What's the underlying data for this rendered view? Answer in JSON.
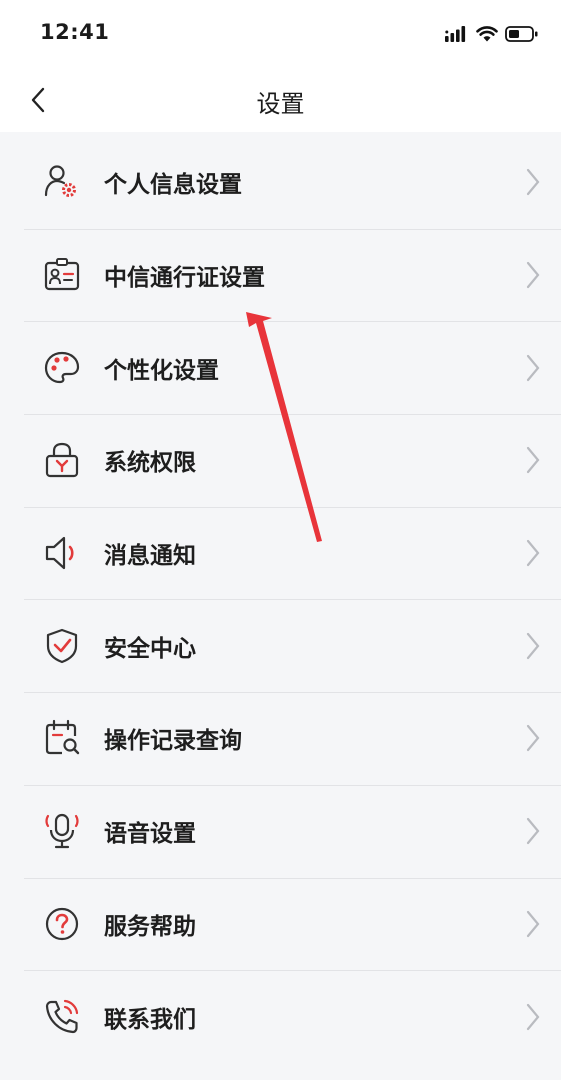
{
  "status_bar": {
    "time": "12:41"
  },
  "header": {
    "title": "设置"
  },
  "menu": {
    "items": [
      {
        "label": "个人信息设置",
        "icon": "user-gear-icon"
      },
      {
        "label": "中信通行证设置",
        "icon": "id-card-icon"
      },
      {
        "label": "个性化设置",
        "icon": "palette-icon"
      },
      {
        "label": "系统权限",
        "icon": "lock-icon"
      },
      {
        "label": "消息通知",
        "icon": "speaker-icon"
      },
      {
        "label": "安全中心",
        "icon": "shield-check-icon"
      },
      {
        "label": "操作记录查询",
        "icon": "calendar-search-icon"
      },
      {
        "label": "语音设置",
        "icon": "microphone-icon"
      },
      {
        "label": "服务帮助",
        "icon": "help-circle-icon"
      },
      {
        "label": "联系我们",
        "icon": "phone-icon"
      }
    ]
  },
  "colors": {
    "accent": "#e23b3b",
    "icon_dark": "#333333",
    "background": "#f5f6f8",
    "annotation_arrow": "#e8343a"
  }
}
